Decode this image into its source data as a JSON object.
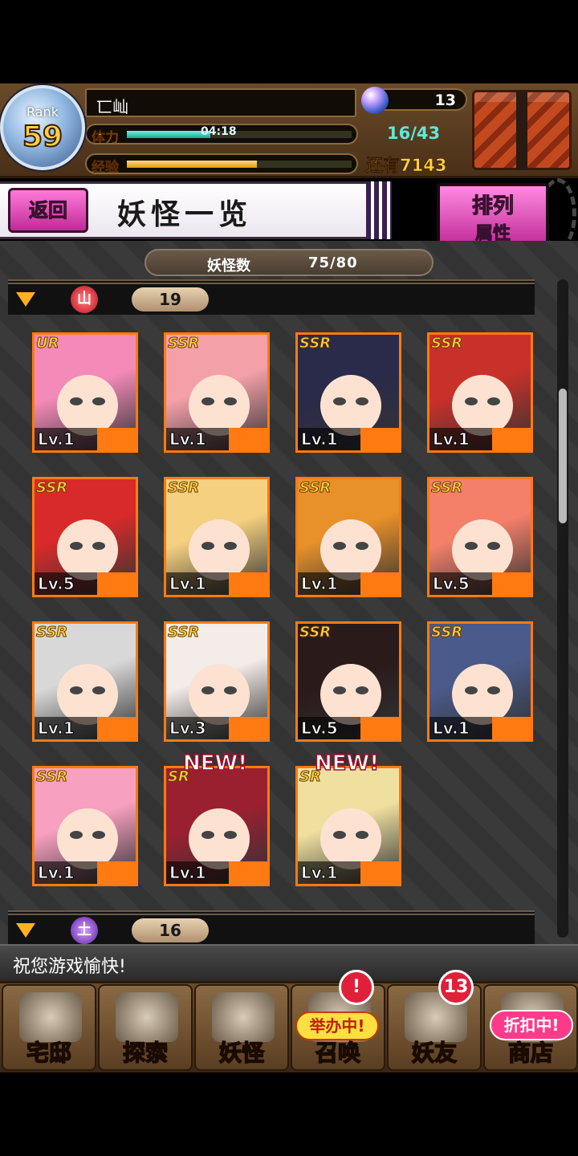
{
  "header": {
    "rank_label": "Rank",
    "rank_value": "59",
    "player_name": "匸屾",
    "stamina_label": "体力",
    "stamina_timer": "04:18",
    "stamina_value": "16/43",
    "stamina_fill": 0.37,
    "exp_label": "经验",
    "exp_remaining": "还有7143",
    "exp_fill": 0.58,
    "orb_count": "13",
    "chest_icon": "treasure-chest-icon"
  },
  "titlebar": {
    "back_label": "返回",
    "title": "妖怪一览",
    "sort_line1": "排列",
    "sort_line2": "属性"
  },
  "list": {
    "count_label": "妖怪数",
    "count_value": "75/80",
    "groups": [
      {
        "icon_char": "山",
        "count": "19",
        "color": "#c01020"
      },
      {
        "icon_char": "土",
        "count": "16",
        "color": "#6020a0"
      }
    ],
    "cards": [
      {
        "rarity": "UR",
        "level": "Lv.1",
        "hair": "#f48ab8"
      },
      {
        "rarity": "SSR",
        "level": "Lv.1",
        "hair": "#f4a0a8"
      },
      {
        "rarity": "SSR",
        "level": "Lv.1",
        "hair": "#2a2a4a"
      },
      {
        "rarity": "SSR",
        "level": "Lv.1",
        "hair": "#c8302a"
      },
      {
        "rarity": "SSR",
        "level": "Lv.5",
        "hair": "#d82a2a"
      },
      {
        "rarity": "SSR",
        "level": "Lv.1",
        "hair": "#f4d080"
      },
      {
        "rarity": "SSR",
        "level": "Lv.1",
        "hair": "#e8902a"
      },
      {
        "rarity": "SSR",
        "level": "Lv.5",
        "hair": "#f4806a"
      },
      {
        "rarity": "SSR",
        "level": "Lv.1",
        "hair": "#d8d8d8"
      },
      {
        "rarity": "SSR",
        "level": "Lv.3",
        "hair": "#f4ece8"
      },
      {
        "rarity": "SSR",
        "level": "Lv.5",
        "hair": "#2a1a1a"
      },
      {
        "rarity": "SSR",
        "level": "Lv.1",
        "hair": "#4a5a8a"
      },
      {
        "rarity": "SSR",
        "level": "Lv.1",
        "hair": "#f8a0c0"
      },
      {
        "rarity": "SR",
        "level": "Lv.1",
        "hair": "#9a2030",
        "new": "NEW!"
      },
      {
        "rarity": "SR",
        "level": "Lv.1",
        "hair": "#f0e0a0",
        "new": "NEW!"
      }
    ]
  },
  "message": "祝您游戏愉快!",
  "nav": {
    "items": [
      {
        "label": "宅邸",
        "icon": "mansion-icon"
      },
      {
        "label": "探索",
        "icon": "magnifier-map-icon"
      },
      {
        "label": "妖怪",
        "icon": "scroll-icon"
      },
      {
        "label": "召唤",
        "icon": "summon-icon"
      },
      {
        "label": "妖友",
        "icon": "friend-icon"
      },
      {
        "label": "商店",
        "icon": "crystal-ball-icon"
      }
    ],
    "summon_badge": "!",
    "summon_tag": "举办中!",
    "friend_badge": "13",
    "shop_tag": "折扣中!"
  },
  "colors": {
    "accent_pink": "#e040b0",
    "card_border": "#ff7a10",
    "stamina": "#5fe8d8",
    "exp": "#ffd23a"
  }
}
